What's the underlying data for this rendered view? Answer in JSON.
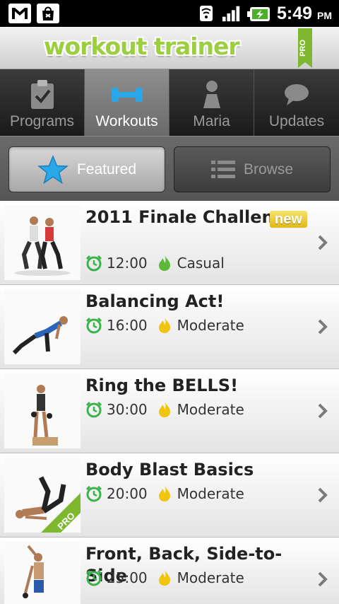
{
  "status_bar": {
    "time": "5:49",
    "ampm": "PM",
    "icons": [
      "gmail-icon",
      "shopping-bag-icon",
      "wifi-icon",
      "signal-icon",
      "battery-charging-icon"
    ]
  },
  "header": {
    "logo_text": "workout trainer",
    "ribbon_text": "PRO"
  },
  "tabs": [
    {
      "label": "Programs",
      "icon": "clipboard-icon",
      "active": false
    },
    {
      "label": "Workouts",
      "icon": "dumbbell-icon",
      "active": true
    },
    {
      "label": "Maria",
      "icon": "person-icon",
      "active": false
    },
    {
      "label": "Updates",
      "icon": "chat-bubble-icon",
      "active": false
    }
  ],
  "segment": {
    "featured_label": "Featured",
    "browse_label": "Browse"
  },
  "workouts": [
    {
      "title": "2011 Finale Challenge",
      "duration": "12:00",
      "intensity": "Casual",
      "badge": "new"
    },
    {
      "title": "Balancing Act!",
      "duration": "16:00",
      "intensity": "Moderate"
    },
    {
      "title": "Ring the BELLS!",
      "duration": "30:00",
      "intensity": "Moderate"
    },
    {
      "title": "Body Blast Basics",
      "duration": "20:00",
      "intensity": "Moderate",
      "thumb_badge": "PRO"
    },
    {
      "title": "Front, Back, Side-to-Side",
      "duration": "25:00",
      "intensity": "Moderate"
    }
  ],
  "colors": {
    "logo_green": "#9bcf3f",
    "accent_blue": "#2aa7e8",
    "clock_green": "#3bb34a",
    "flame_yellow": "#f1c40f",
    "flame_green": "#5cb83a",
    "badge_yellow": "#e8c52a"
  }
}
